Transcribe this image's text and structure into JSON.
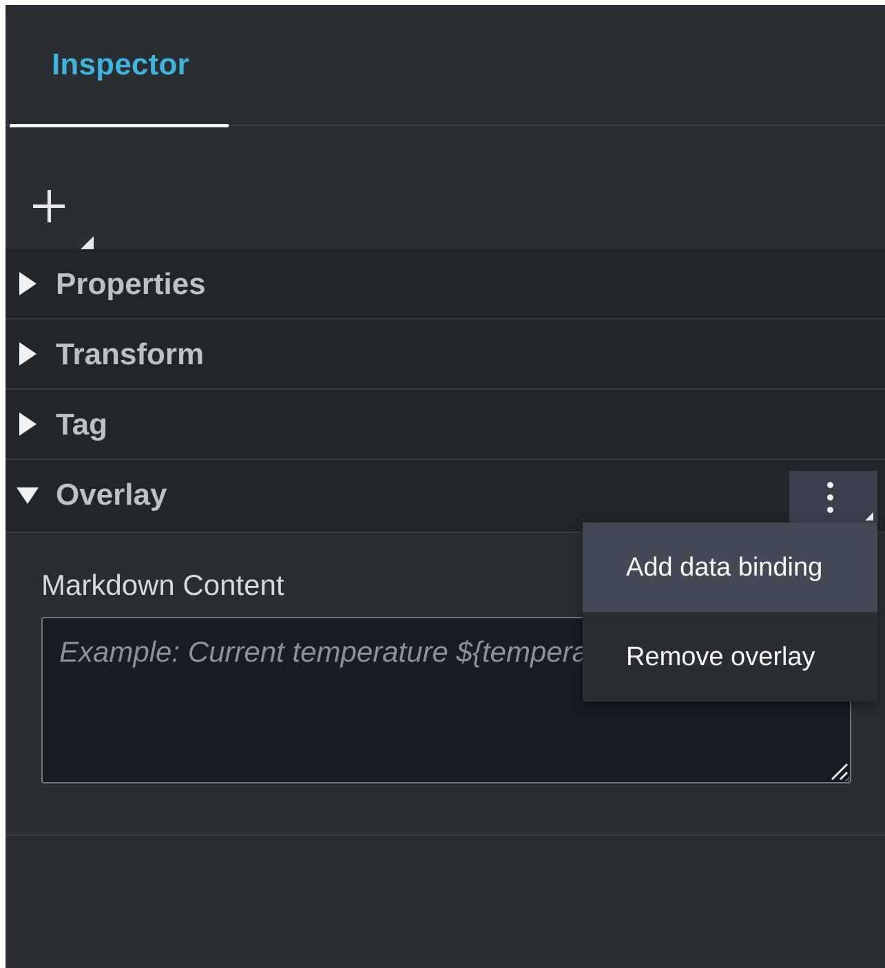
{
  "tabs": [
    {
      "label": "Inspector",
      "active": true
    }
  ],
  "toolbar": {
    "add_icon": "plus-icon"
  },
  "sections": [
    {
      "label": "Properties",
      "expanded": false
    },
    {
      "label": "Transform",
      "expanded": false
    },
    {
      "label": "Tag",
      "expanded": false
    },
    {
      "label": "Overlay",
      "expanded": true
    }
  ],
  "overlay": {
    "field_label": "Markdown Content",
    "placeholder": "Example: Current temperature ${temperature.name}",
    "value": ""
  },
  "actions_menu": {
    "icon": "more-vertical-icon",
    "items": [
      {
        "label": "Add data binding",
        "highlighted": true
      },
      {
        "label": "Remove overlay",
        "highlighted": false
      }
    ]
  },
  "colors": {
    "accent": "#3fb4dc",
    "panel_bg": "#2a2e33",
    "header_bg": "#22262b",
    "input_bg": "#191c26",
    "menu_hover": "#434a55"
  }
}
